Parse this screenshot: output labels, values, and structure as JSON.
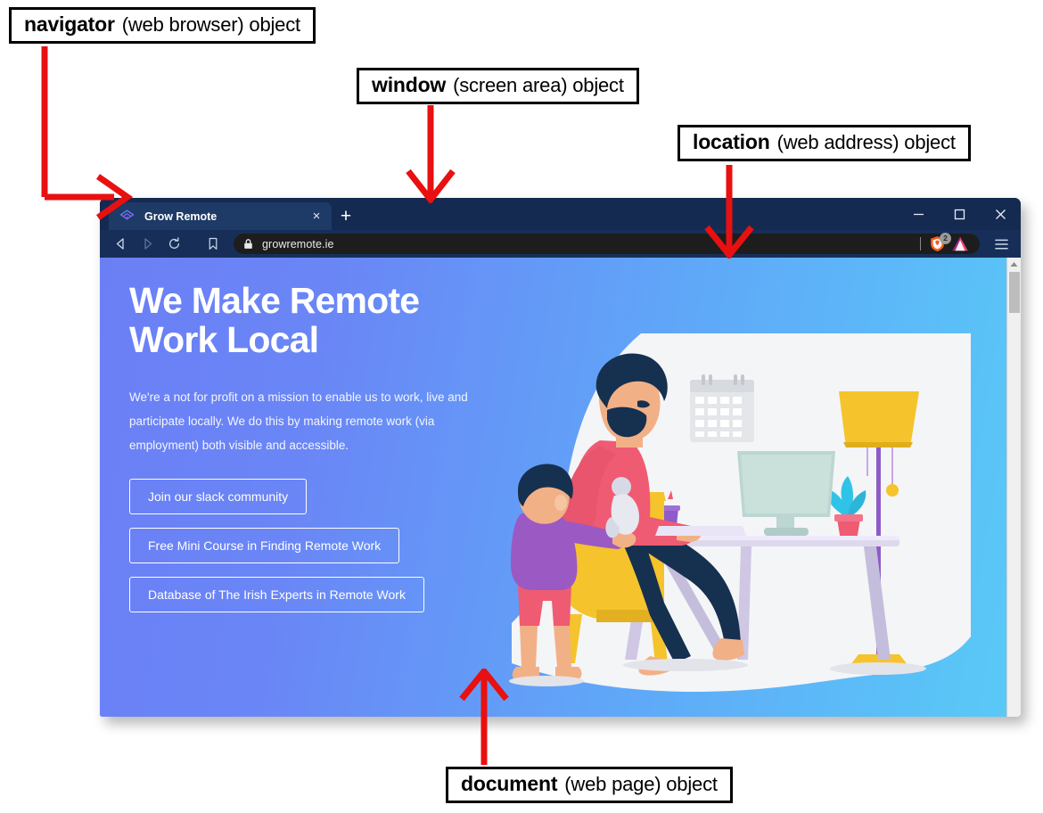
{
  "annotations": [
    {
      "id": "navigator",
      "term": "navigator",
      "desc": "(web browser) object",
      "arrow": "elbow-down-right"
    },
    {
      "id": "window",
      "term": "window",
      "desc": "(screen area) object",
      "arrow": "down"
    },
    {
      "id": "location",
      "term": "location",
      "desc": "(web address) object",
      "arrow": "down"
    },
    {
      "id": "document",
      "term": "document",
      "desc": "(web page) object",
      "arrow": "up"
    }
  ],
  "browser": {
    "tab": {
      "title": "Grow Remote",
      "favicon_icon": "grow-remote-logo-icon",
      "close_label": "×"
    },
    "new_tab_label": "+",
    "window_controls": {
      "minimize_icon": "minimize-icon",
      "maximize_icon": "maximize-icon",
      "close_icon": "close-icon"
    },
    "toolbar": {
      "back_icon": "back-arrow-icon",
      "forward_icon": "forward-arrow-icon",
      "reload_icon": "reload-icon",
      "bookmark_icon": "bookmark-icon",
      "menu_icon": "hamburger-menu-icon",
      "shield_icon": "brave-shield-lion-icon",
      "shield_badge": "2",
      "brave_logo_icon": "brave-triangle-logo-icon"
    },
    "url": {
      "lock_icon": "lock-icon",
      "value": "growremote.ie"
    },
    "scrollbar": {
      "up_arrow_icon": "scroll-up-arrow-icon"
    }
  },
  "page": {
    "headline": "We Make Remote\nWork Local",
    "subcopy": "We're a not for profit on a mission to enable us to work, live and participate locally. We do this by making remote work (via employment) both visible and accessible.",
    "ctas": [
      {
        "label": "Join our slack community"
      },
      {
        "label": "Free Mini Course in Finding Remote Work"
      },
      {
        "label": "Database of The Irish Experts in Remote Work"
      }
    ],
    "illustration_name": "remote-worker-with-child-illustration"
  },
  "colors": {
    "gradient_start": "#6b7ff5",
    "gradient_end": "#59c9f7",
    "chrome_dark": "#152a50",
    "toolbar": "#172f58",
    "tab_active": "#1e3a66",
    "url_field": "#1d1d1d",
    "annotation_arrow": "#e81010",
    "accent_yellow": "#ffc93c",
    "accent_pink": "#ef5b72",
    "accent_purple": "#9b59c4",
    "navy": "#16304f"
  }
}
